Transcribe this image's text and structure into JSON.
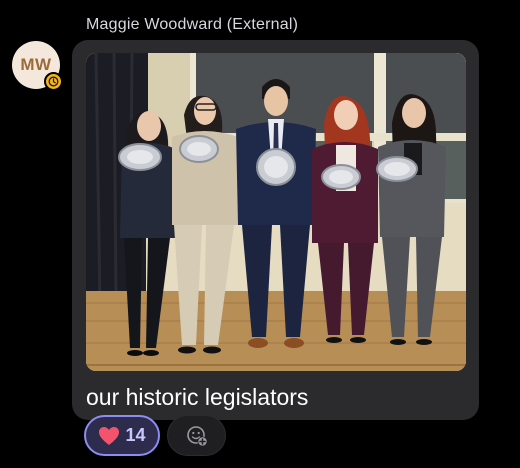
{
  "message": {
    "sender_name": "Maggie Woodward (External)",
    "avatar_initials": "MW",
    "status_icon": "clock-icon",
    "caption": "our historic legislators",
    "photo_alt": "our historic legislators"
  },
  "reactions": {
    "heart_icon": "heart-icon",
    "heart_count": "14",
    "add_reaction_icon": "add-reaction-icon"
  },
  "colors": {
    "background": "#000000",
    "bubble": "#2b2b2e",
    "reaction_border": "#8d8cf3",
    "reaction_text": "#c8c8ff",
    "heart": "#f2546e",
    "avatar_bg": "#f4e8dc",
    "avatar_text": "#9b6b3a",
    "status_badge": "#f3b51c"
  }
}
